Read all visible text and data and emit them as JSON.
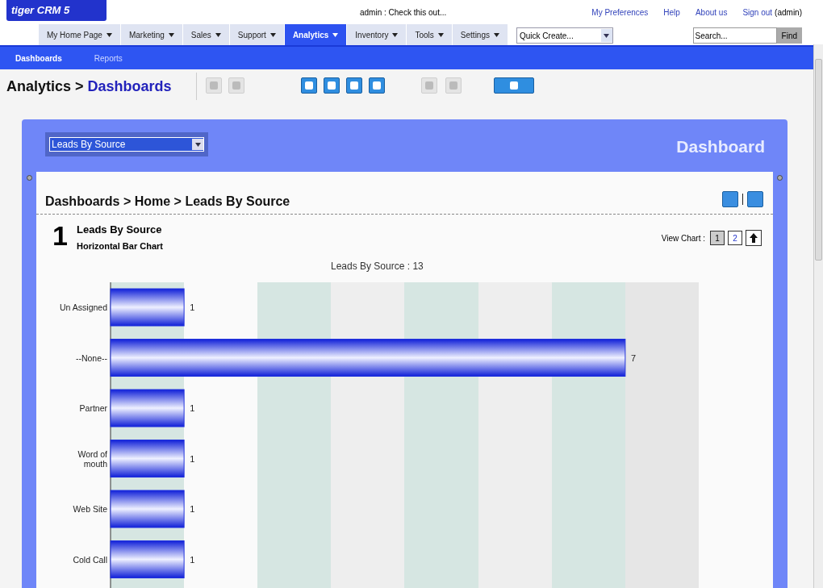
{
  "header": {
    "logo": "tiger CRM 5",
    "message": "admin : Check this out...",
    "links": [
      "My Preferences",
      "Help",
      "About us"
    ],
    "sign_out": "Sign out",
    "user": "(admin)"
  },
  "nav": {
    "tabs": [
      {
        "label": "My Home Page",
        "selected": false
      },
      {
        "label": "Marketing",
        "selected": false
      },
      {
        "label": "Sales",
        "selected": false
      },
      {
        "label": "Support",
        "selected": false
      },
      {
        "label": "Analytics",
        "selected": true
      },
      {
        "label": "Inventory",
        "selected": false
      },
      {
        "label": "Tools",
        "selected": false
      },
      {
        "label": "Settings",
        "selected": false
      }
    ],
    "quick_create": "Quick Create...",
    "search": {
      "placeholder": "Search..."
    },
    "find_button": "Find"
  },
  "subnav": [
    {
      "label": "Dashboards",
      "selected": true
    },
    {
      "label": "Reports",
      "selected": false
    }
  ],
  "page_title": {
    "module": "Analytics",
    "separator": ">",
    "page": "Dashboards"
  },
  "toolbar": [
    {
      "disabled": true
    },
    {
      "disabled": true
    },
    {
      "disabled": false
    },
    {
      "disabled": false
    },
    {
      "disabled": false
    },
    {
      "disabled": false
    },
    {
      "disabled": true
    },
    {
      "disabled": true
    },
    {
      "disabled": false
    }
  ],
  "dashboard": {
    "selector": "Leads By Source",
    "heading": "Dashboard",
    "breadcrumb": "Dashboards > Home > Leads By Source",
    "chart_number": "1",
    "chart_title": "Leads By Source",
    "chart_subtitle": "Horizontal Bar Chart",
    "view_chart_label": "View Chart :",
    "view_buttons": [
      {
        "label": "1",
        "selected": true
      },
      {
        "label": "2",
        "selected": false
      }
    ],
    "chart_data": {
      "type": "bar",
      "orientation": "horizontal",
      "title": "Leads By Source : 13",
      "categories": [
        "Un Assigned",
        "--None--",
        "Partner",
        "Word of mouth",
        "Web Site",
        "Cold Call"
      ],
      "series": [
        {
          "color": "#2233dd",
          "values": [
            1,
            7,
            1,
            1,
            1,
            1
          ]
        }
      ],
      "xlim": [
        0,
        8
      ],
      "data_labels": true
    }
  }
}
